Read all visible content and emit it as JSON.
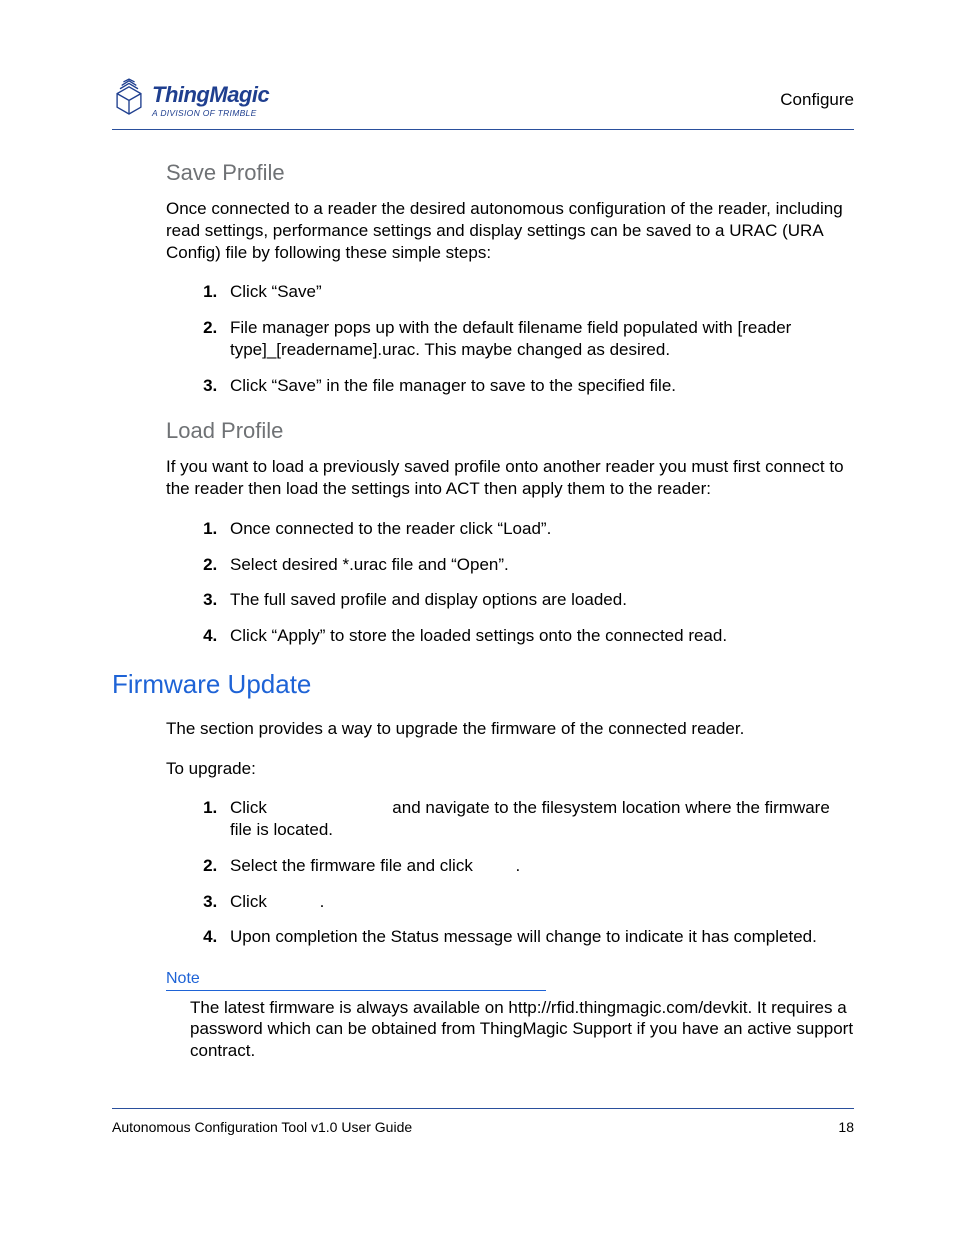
{
  "header": {
    "logo_name": "ThingMagic",
    "logo_tagline": "A DIVISION OF TRIMBLE",
    "right_label": "Configure"
  },
  "sections": {
    "save_profile": {
      "title": "Save Profile",
      "intro": "Once connected to a reader the desired autonomous configuration of the reader, including read settings, performance settings and display settings can be saved to a URAC (URA Config) file by following these simple steps:",
      "steps": [
        "Click “Save”",
        "File manager pops up with the default filename field populated with [reader type]_[readername].urac. This maybe changed as desired.",
        "Click “Save” in the file manager to save to the specified file."
      ]
    },
    "load_profile": {
      "title": "Load Profile",
      "intro": "If you want to load a previously saved profile onto another reader you must first connect to the reader then load the settings into ACT then apply them to the reader:",
      "steps": [
        "Once connected to the reader click “Load”.",
        "Select desired *.urac file and “Open”.",
        "The full saved profile and display options are loaded.",
        "Click “Apply” to store the loaded settings onto the connected read."
      ]
    },
    "firmware_update": {
      "title": "Firmware Update",
      "intro": "The section provides a way to upgrade the firmware of the connected reader.",
      "lead": "To upgrade:",
      "step1_a": "Click ",
      "step1_b": " and navigate to the filesystem location where the firmware file is located.",
      "step2_a": "Select the firmware file and click ",
      "step2_b": ".",
      "step3_a": "Click ",
      "step3_b": ".",
      "step4": "Upon completion the Status message will change to indicate it has completed.",
      "note_label": "Note",
      "note_text": "The latest firmware is always available on http://rfid.thingmagic.com/devkit. It requires a password which can be obtained from ThingMagic Support if you have an active support contract."
    }
  },
  "footer": {
    "left": "Autonomous Configuration Tool v1.0 User Guide",
    "right": "18"
  }
}
